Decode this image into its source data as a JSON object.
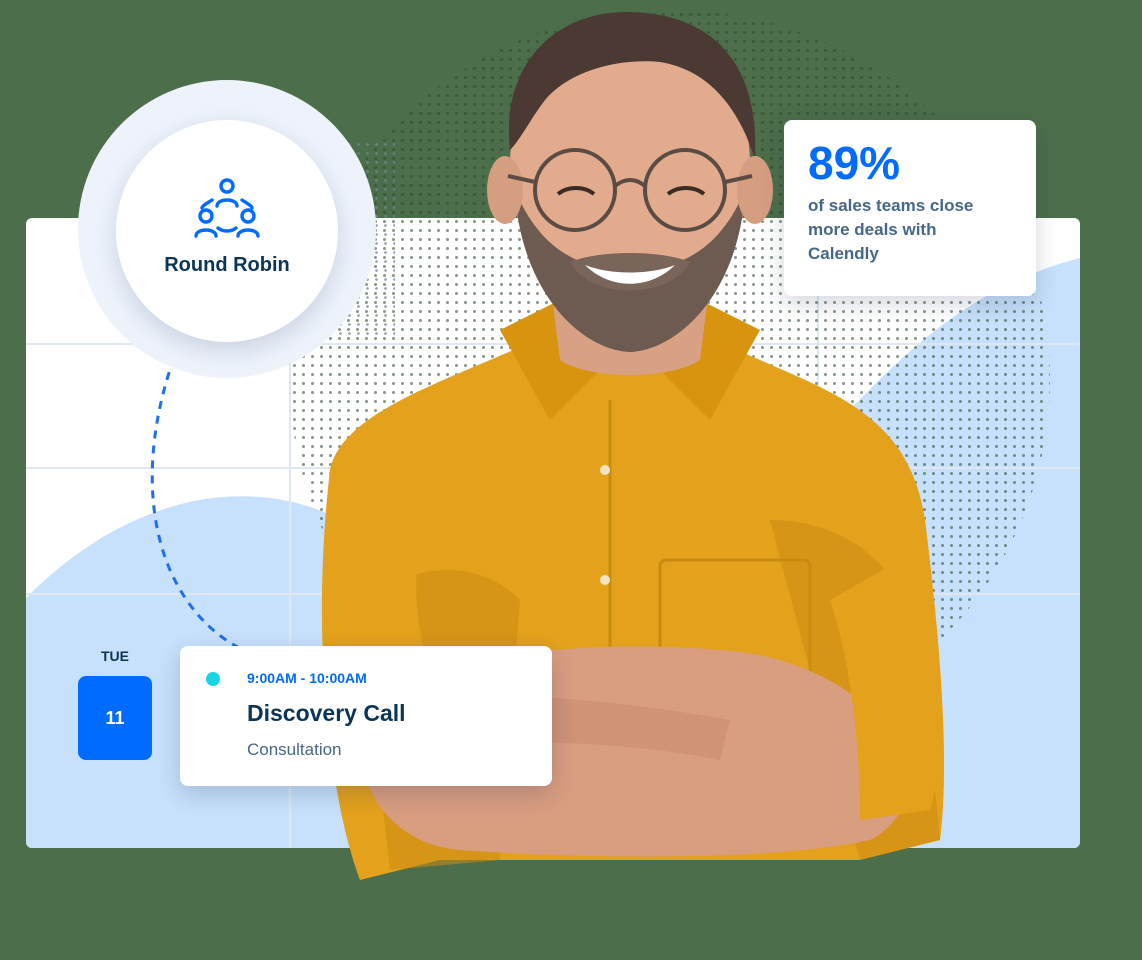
{
  "round_robin": {
    "label": "Round Robin",
    "icon": "team-rotation-icon"
  },
  "stat": {
    "value": "89%",
    "line1": "of sales teams close",
    "line2": "more deals with",
    "line3": "Calendly"
  },
  "event": {
    "day_name": "TUE",
    "day_number": "11",
    "time": "9:00AM - 10:00AM",
    "title": "Discovery Call",
    "subtitle": "Consultation"
  },
  "colors": {
    "accent": "#006bff",
    "navy": "#0b3558",
    "slate": "#476788",
    "dot": "#16d6e6",
    "shirt": "#e0a01a",
    "wave": "#c7e0fb"
  }
}
